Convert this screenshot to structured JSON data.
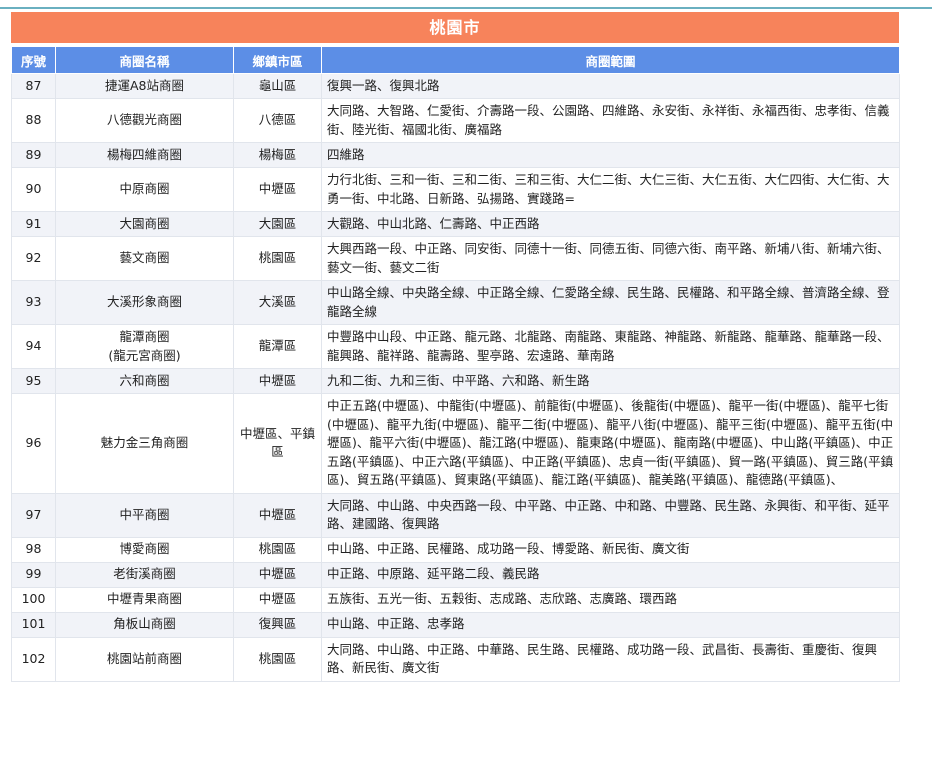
{
  "city_title": "桃園市",
  "columns": [
    "序號",
    "商圈名稱",
    "鄉鎮市區",
    "商圈範圍"
  ],
  "rows": [
    {
      "no": "87",
      "name": "捷運A8站商圈",
      "district": "龜山區",
      "area": "復興一路、復興北路"
    },
    {
      "no": "88",
      "name": "八德觀光商圈",
      "district": "八德區",
      "area": "大同路、大智路、仁愛街、介壽路一段、公園路、四維路、永安街、永祥街、永福西街、忠孝街、信義街、陸光街、福國北街、廣福路"
    },
    {
      "no": "89",
      "name": "楊梅四維商圈",
      "district": "楊梅區",
      "area": "四維路"
    },
    {
      "no": "90",
      "name": "中原商圈",
      "district": "中壢區",
      "area": "力行北街、三和一街、三和二街、三和三街、大仁二街、大仁三街、大仁五街、大仁四街、大仁街、大勇一街、中北路、日新路、弘揚路、實踐路="
    },
    {
      "no": "91",
      "name": "大園商圈",
      "district": "大園區",
      "area": "大觀路、中山北路、仁壽路、中正西路"
    },
    {
      "no": "92",
      "name": "藝文商圈",
      "district": "桃園區",
      "area": "大興西路一段、中正路、同安街、同德十一街、同德五街、同德六街、南平路、新埔八街、新埔六街、藝文一街、藝文二街"
    },
    {
      "no": "93",
      "name": "大溪形象商圈",
      "district": "大溪區",
      "area": "中山路全線、中央路全線、中正路全線、仁愛路全線、民生路、民權路、和平路全線、普濟路全線、登龍路全線"
    },
    {
      "no": "94",
      "name": "龍潭商圈\n(龍元宮商圈)",
      "district": "龍潭區",
      "area": "中豐路中山段、中正路、龍元路、北龍路、南龍路、東龍路、神龍路、新龍路、龍華路、龍華路一段、龍興路、龍祥路、龍壽路、聖亭路、宏遠路、華南路"
    },
    {
      "no": "95",
      "name": "六和商圈",
      "district": "中壢區",
      "area": "九和二街、九和三街、中平路、六和路、新生路"
    },
    {
      "no": "96",
      "name": "魅力金三角商圈",
      "district": "中壢區、平鎮區",
      "area": "中正五路(中壢區)、中龍街(中壢區)、前龍街(中壢區)、後龍街(中壢區)、龍平一街(中壢區)、龍平七街(中壢區)、龍平九街(中壢區)、龍平二街(中壢區)、龍平八街(中壢區)、龍平三街(中壢區)、龍平五街(中壢區)、龍平六街(中壢區)、龍江路(中壢區)、龍東路(中壢區)、龍南路(中壢區)、中山路(平鎮區)、中正五路(平鎮區)、中正六路(平鎮區)、中正路(平鎮區)、忠貞一街(平鎮區)、貿一路(平鎮區)、貿三路(平鎮區)、貿五路(平鎮區)、貿東路(平鎮區)、龍江路(平鎮區)、龍美路(平鎮區)、龍德路(平鎮區)、"
    },
    {
      "no": "97",
      "name": "中平商圈",
      "district": "中壢區",
      "area": "大同路、中山路、中央西路一段、中平路、中正路、中和路、中豐路、民生路、永興街、和平街、延平路、建國路、復興路"
    },
    {
      "no": "98",
      "name": "博愛商圈",
      "district": "桃園區",
      "area": "中山路、中正路、民權路、成功路一段、博愛路、新民街、廣文街"
    },
    {
      "no": "99",
      "name": "老街溪商圈",
      "district": "中壢區",
      "area": "中正路、中原路、延平路二段、義民路"
    },
    {
      "no": "100",
      "name": "中壢青果商圈",
      "district": "中壢區",
      "area": "五族街、五光一街、五穀街、志成路、志欣路、志廣路、環西路"
    },
    {
      "no": "101",
      "name": "角板山商圈",
      "district": "復興區",
      "area": "中山路、中正路、忠孝路"
    },
    {
      "no": "102",
      "name": "桃園站前商圈",
      "district": "桃園區",
      "area": "大同路、中山路、中正路、中華路、民生路、民權路、成功路一段、武昌街、長壽街、重慶街、復興路、新民街、廣文街"
    }
  ]
}
